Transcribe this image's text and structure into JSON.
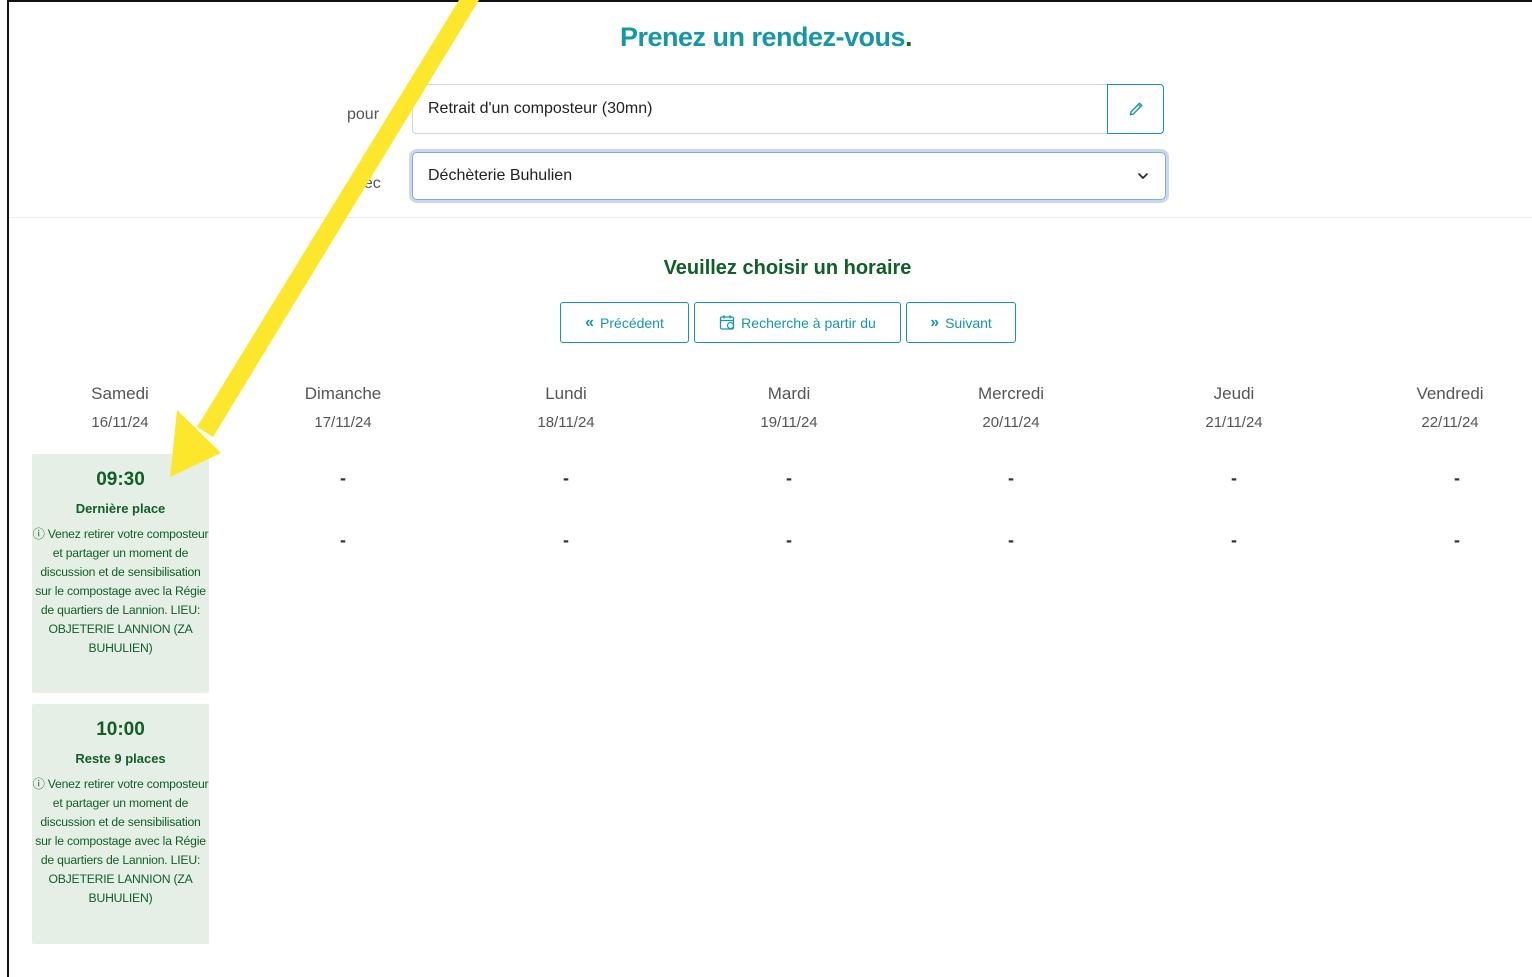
{
  "page": {
    "title": "Prenez un rendez-vous",
    "title_dot": "."
  },
  "form": {
    "pour_label": "pour",
    "pour_value": "Retrait d'un composteur (30mn)",
    "avec_label": "avec",
    "avec_value": "Déchèterie Buhulien"
  },
  "schedule": {
    "heading": "Veuillez choisir un horaire",
    "prev_label": "Précédent",
    "search_label": "Recherche à partir du",
    "next_label": "Suivant",
    "days": [
      {
        "name": "Samedi",
        "date": "16/11/24"
      },
      {
        "name": "Dimanche",
        "date": "17/11/24"
      },
      {
        "name": "Lundi",
        "date": "18/11/24"
      },
      {
        "name": "Mardi",
        "date": "19/11/24"
      },
      {
        "name": "Mercredi",
        "date": "20/11/24"
      },
      {
        "name": "Jeudi",
        "date": "21/11/24"
      },
      {
        "name": "Vendredi",
        "date": "22/11/24"
      }
    ],
    "empty_marker": "-",
    "slots": [
      {
        "time": "09:30",
        "availability": "Dernière place",
        "info": "ⓘ Venez retirer votre composteur et partager un moment de discussion et de sensibilisation sur le compostage avec la Régie de quartiers de Lannion. LIEU: OBJETERIE LANNION (ZA BUHULIEN)"
      },
      {
        "time": "10:00",
        "availability": "Reste 9 places",
        "info": "ⓘ Venez retirer votre composteur et partager un moment de discussion et de sensibilisation sur le compostage avec la Régie de quartiers de Lannion. LIEU: OBJETERIE LANNION (ZA BUHULIEN)"
      }
    ]
  },
  "colors": {
    "title": "#1597a7",
    "accent_green": "#0f5f26",
    "slot_bg": "#e5efe6",
    "annotation_arrow": "#fde72c"
  },
  "icons": {
    "edit": "pencil-icon",
    "dropdown": "chevron-down-icon",
    "prev": "double-chevron-left-icon",
    "search": "calendar-icon",
    "next": "double-chevron-right-icon"
  }
}
